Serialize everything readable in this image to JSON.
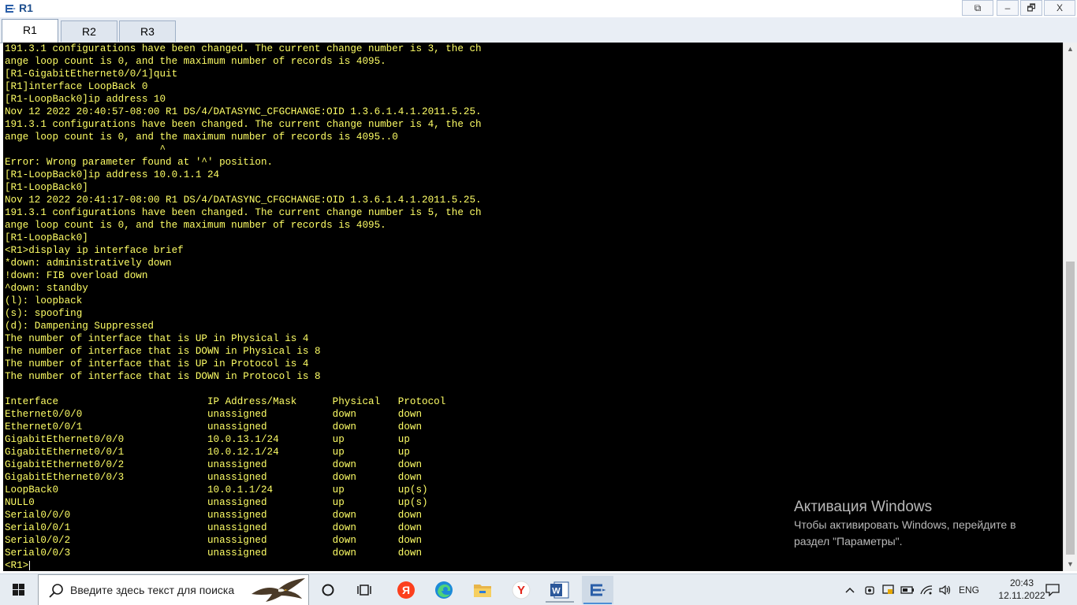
{
  "window": {
    "title": "R1"
  },
  "window_controls": {
    "restore_label": "⧉",
    "minimize_label": "–",
    "maximize_label": "🗗",
    "close_label": "X"
  },
  "tabs": [
    {
      "label": "R1",
      "active": true
    },
    {
      "label": "R2",
      "active": false
    },
    {
      "label": "R3",
      "active": false
    }
  ],
  "terminal": {
    "lines": [
      "191.3.1 configurations have been changed. The current change number is 3, the ch",
      "ange loop count is 0, and the maximum number of records is 4095.",
      "[R1-GigabitEthernet0/0/1]quit",
      "[R1]interface LoopBack 0",
      "[R1-LoopBack0]ip address 10",
      "Nov 12 2022 20:40:57-08:00 R1 DS/4/DATASYNC_CFGCHANGE:OID 1.3.6.1.4.1.2011.5.25.",
      "191.3.1 configurations have been changed. The current change number is 4, the ch",
      "ange loop count is 0, and the maximum number of records is 4095..0",
      "                          ^",
      "Error: Wrong parameter found at '^' position.",
      "[R1-LoopBack0]ip address 10.0.1.1 24",
      "[R1-LoopBack0]",
      "Nov 12 2022 20:41:17-08:00 R1 DS/4/DATASYNC_CFGCHANGE:OID 1.3.6.1.4.1.2011.5.25.",
      "191.3.1 configurations have been changed. The current change number is 5, the ch",
      "ange loop count is 0, and the maximum number of records is 4095.",
      "[R1-LoopBack0]",
      "<R1>display ip interface brief",
      "*down: administratively down",
      "!down: FIB overload down",
      "^down: standby",
      "(l): loopback",
      "(s): spoofing",
      "(d): Dampening Suppressed",
      "The number of interface that is UP in Physical is 4",
      "The number of interface that is DOWN in Physical is 8",
      "The number of interface that is UP in Protocol is 4",
      "The number of interface that is DOWN in Protocol is 8",
      "",
      "Interface                         IP Address/Mask      Physical   Protocol",
      "Ethernet0/0/0                     unassigned           down       down",
      "Ethernet0/0/1                     unassigned           down       down",
      "GigabitEthernet0/0/0              10.0.13.1/24         up         up",
      "GigabitEthernet0/0/1              10.0.12.1/24         up         up",
      "GigabitEthernet0/0/2              unassigned           down       down",
      "GigabitEthernet0/0/3              unassigned           down       down",
      "LoopBack0                         10.0.1.1/24          up         up(s)",
      "NULL0                             unassigned           up         up(s)",
      "Serial0/0/0                       unassigned           down       down",
      "Serial0/0/1                       unassigned           down       down",
      "Serial0/0/2                       unassigned           down       down",
      "Serial0/0/3                       unassigned           down       down"
    ],
    "prompt": "<R1>",
    "text_color": "#ffff66",
    "background": "#000000"
  },
  "scrollbar": {
    "up_arrow": "▲",
    "down_arrow": "▼"
  },
  "watermark": {
    "title": "Активация Windows",
    "subtitle": "Чтобы активировать Windows, перейдите в раздел \"Параметры\"."
  },
  "taskbar": {
    "search_placeholder": "Введите здесь текст для поиска",
    "apps": [
      {
        "name": "cortana-icon"
      },
      {
        "name": "task-view-icon"
      },
      {
        "name": "yandex-icon",
        "label": "Я"
      },
      {
        "name": "edge-icon"
      },
      {
        "name": "file-explorer-icon"
      },
      {
        "name": "yandex-browser-icon",
        "label": "Y"
      },
      {
        "name": "word-icon",
        "label": "W"
      },
      {
        "name": "ensp-icon",
        "active": true
      }
    ],
    "tray": {
      "language": "ENG",
      "time": "20:43",
      "date": "12.11.2022"
    }
  }
}
